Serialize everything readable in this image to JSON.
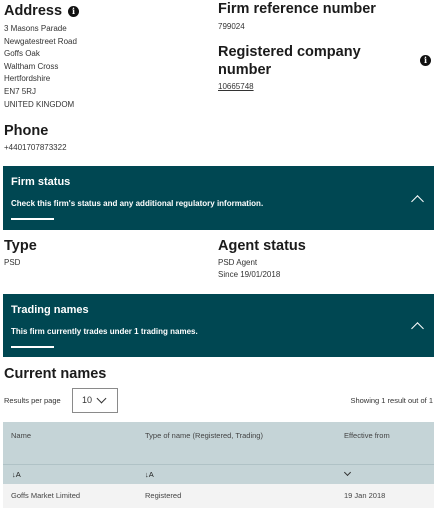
{
  "address": {
    "heading": "Address",
    "lines": [
      "3 Masons Parade",
      "Newgatestreet Road",
      "Goffs Oak",
      "Waltham Cross",
      "Hertfordshire",
      "EN7 5RJ",
      "UNITED KINGDOM"
    ]
  },
  "phone": {
    "heading": "Phone",
    "value": "+4401707873322"
  },
  "firm_reference": {
    "heading": "Firm reference number",
    "value": "799024"
  },
  "registered_company": {
    "heading_line1": "Registered company",
    "heading_line2": "number",
    "value": "10665748"
  },
  "firm_status_panel": {
    "title": "Firm status",
    "description": "Check this firm's status and any additional regulatory information."
  },
  "type": {
    "heading": "Type",
    "value": "PSD"
  },
  "agent_status": {
    "heading": "Agent status",
    "value": "PSD Agent",
    "since": "Since 19/01/2018"
  },
  "trading_names_panel": {
    "title": "Trading names",
    "description": "This firm currently trades under 1 trading names."
  },
  "current_names": {
    "heading": "Current names",
    "results_per_page_label": "Results per page",
    "results_per_page_value": "10",
    "showing_text": "Showing 1 result out of 1",
    "columns": [
      "Name",
      "Type of name (Registered, Trading)",
      "Effective from"
    ],
    "sort_labels": [
      "↓A",
      "↓A"
    ],
    "rows": [
      {
        "name": "Goffs Market Limited",
        "type": "Registered",
        "effective_from": "19 Jan 2018"
      }
    ]
  }
}
